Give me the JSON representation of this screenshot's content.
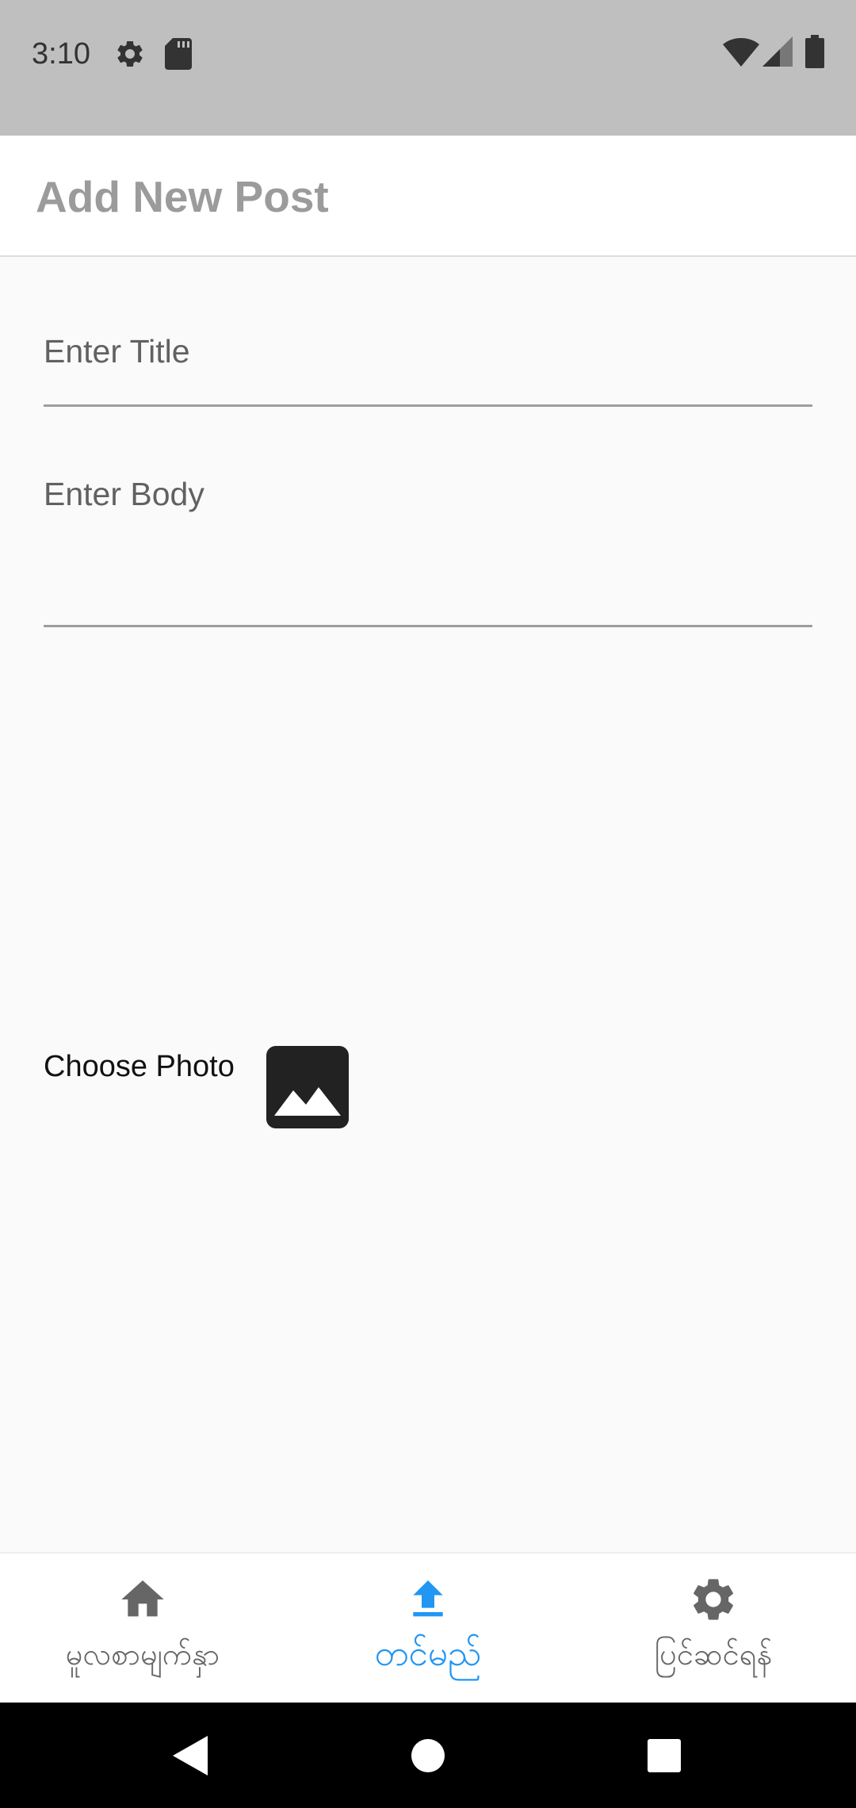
{
  "status_bar": {
    "time": "3:10",
    "left_icons": [
      "gear-icon",
      "sd-card-icon"
    ],
    "right_icons": [
      "wifi-icon",
      "signal-icon",
      "battery-icon"
    ]
  },
  "app_bar": {
    "title": "Add New Post"
  },
  "form": {
    "title_placeholder": "Enter Title",
    "body_placeholder": "Enter Body",
    "choose_photo_label": "Choose Photo",
    "photo_icon": "image-icon"
  },
  "bottom_nav": {
    "items": [
      {
        "label": "မူလစာမျက်နှာ",
        "icon": "home-icon",
        "active": false
      },
      {
        "label": "တင်မည်",
        "icon": "upload-icon",
        "active": true
      },
      {
        "label": "ပြင်ဆင်ရန်",
        "icon": "settings-icon",
        "active": false
      }
    ],
    "active_color": "#2196f3",
    "inactive_color": "#666666"
  },
  "system_nav": {
    "buttons": [
      "back-icon",
      "home-circle-icon",
      "recents-icon"
    ]
  }
}
